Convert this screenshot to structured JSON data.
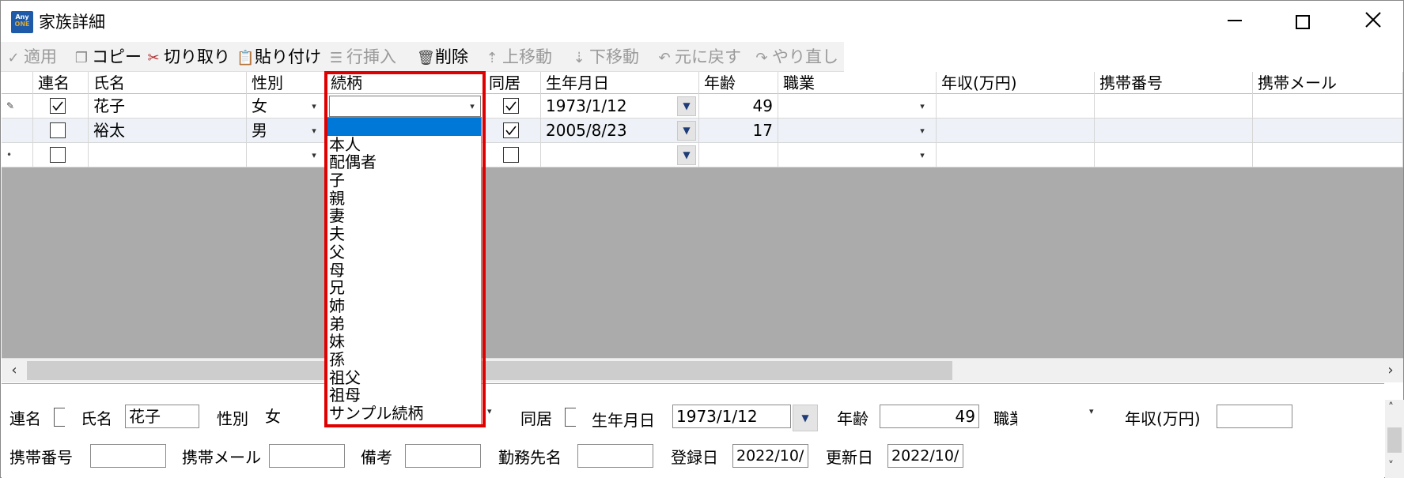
{
  "window": {
    "title": "家族詳細",
    "app_icon": {
      "line1": "Any",
      "line2": "ONE"
    }
  },
  "toolbar": {
    "items": [
      {
        "label": "適用",
        "icon": "check-icon",
        "enabled": false
      },
      {
        "label": "コピー",
        "icon": "copy-icon",
        "enabled": true
      },
      {
        "label": "切り取り",
        "icon": "scissors-icon",
        "enabled": true
      },
      {
        "label": "貼り付け",
        "icon": "paste-icon",
        "enabled": true
      },
      {
        "label": "行挿入",
        "icon": "insert-row-icon",
        "enabled": false
      },
      {
        "label": "削除",
        "icon": "trash-icon",
        "enabled": true
      },
      {
        "label": "上移動",
        "icon": "move-up-icon",
        "enabled": false
      },
      {
        "label": "下移動",
        "icon": "move-down-icon",
        "enabled": false
      },
      {
        "label": "元に戻す",
        "icon": "undo-icon",
        "enabled": false
      },
      {
        "label": "やり直し",
        "icon": "redo-icon",
        "enabled": false
      }
    ]
  },
  "grid": {
    "columns": [
      "連名",
      "氏名",
      "性別",
      "続柄",
      "同居",
      "生年月日",
      "年齢",
      "職業",
      "年収(万円)",
      "携帯番号",
      "携帯メール"
    ],
    "rows": [
      {
        "renmei": true,
        "name": "花子",
        "gender": "女",
        "relation": "",
        "dokyo": true,
        "birth": "1973/1/12",
        "age": "49",
        "job": "",
        "income": "",
        "phone": "",
        "mail": ""
      },
      {
        "renmei": false,
        "name": "裕太",
        "gender": "男",
        "relation": "",
        "dokyo": true,
        "birth": "2005/8/23",
        "age": "17",
        "job": "",
        "income": "",
        "phone": "",
        "mail": ""
      },
      {
        "renmei": false,
        "name": "",
        "gender": "",
        "relation": "",
        "dokyo": false,
        "birth": "",
        "age": "",
        "job": "",
        "income": "",
        "phone": "",
        "mail": ""
      }
    ]
  },
  "relation_dropdown": {
    "options": [
      "",
      "本人",
      "配偶者",
      "子",
      "親",
      "妻",
      "夫",
      "父",
      "母",
      "兄",
      "姉",
      "弟",
      "妹",
      "孫",
      "祖父",
      "祖母",
      "サンプル続柄"
    ],
    "selected_index": 0,
    "highlight_color": "#e00000"
  },
  "detail": {
    "renmei_label": "連名",
    "name_label": "氏名",
    "name_value": "花子",
    "gender_label": "性別",
    "gender_value": "女",
    "dokyo_label": "同居",
    "birth_label": "生年月日",
    "birth_value": "1973/1/12",
    "age_label": "年齢",
    "age_value": "49",
    "job_label": "職業",
    "job_value": "",
    "income_label": "年収(万円)",
    "income_value": "",
    "phone_label": "携帯番号",
    "phone_value": "",
    "mail_label": "携帯メール",
    "mail_value": "",
    "note_label": "備考",
    "note_value": "",
    "company_label": "勤務先名",
    "company_value": "",
    "registered_label": "登録日",
    "registered_value": "2022/10/",
    "updated_label": "更新日",
    "updated_value": "2022/10/"
  }
}
